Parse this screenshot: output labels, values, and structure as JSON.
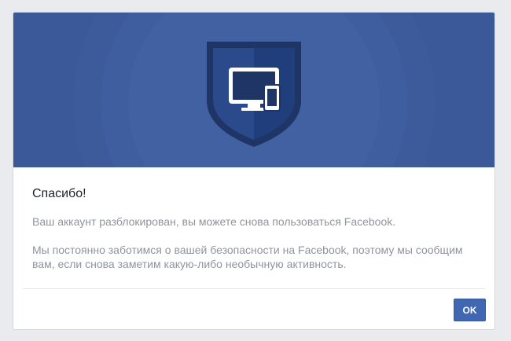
{
  "dialog": {
    "title": "Спасибо!",
    "message": "Ваш аккаунт разблокирован, вы можете снова пользоваться Facebook.",
    "details": "Мы постоянно заботимся о вашей безопасности на Facebook, поэтому мы сообщим вам, если снова заметим какую-либо необычную активность.",
    "ok_label": "OK"
  },
  "banner": {
    "icon": "shield-devices-icon",
    "background_color": "#3b5998"
  },
  "colors": {
    "button": "#4267b2",
    "secondary_text": "#90949c",
    "page_background": "#e9ebee"
  }
}
